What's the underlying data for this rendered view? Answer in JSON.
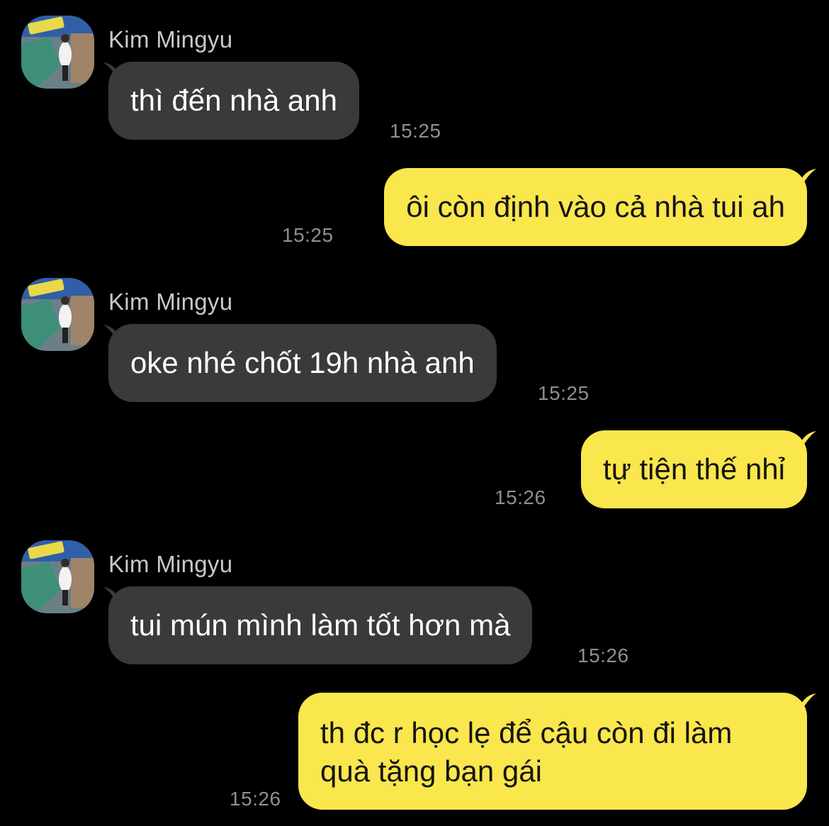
{
  "chat": {
    "messages": [
      {
        "side": "in",
        "sender": "Kim Mingyu",
        "text": "thì đến nhà anh",
        "time": "15:25"
      },
      {
        "side": "out",
        "text": "ôi còn định vào cả nhà tui ah",
        "time": "15:25"
      },
      {
        "side": "in",
        "sender": "Kim Mingyu",
        "text": "oke nhé chốt 19h nhà anh",
        "time": "15:25"
      },
      {
        "side": "out",
        "text": "tự tiện thế nhỉ",
        "time": "15:26"
      },
      {
        "side": "in",
        "sender": "Kim Mingyu",
        "text": "tui mún mình làm tốt hơn mà",
        "time": "15:26"
      },
      {
        "side": "out",
        "text": "th đc r học lẹ để cậu còn đi làm quà tặng bạn gái",
        "time": "15:26"
      }
    ]
  },
  "colors": {
    "background": "#000000",
    "incoming_bubble": "#3a3a3c",
    "outgoing_bubble": "#fae64d",
    "timestamp": "#8e8e93"
  },
  "icons": {
    "avatar": "contact-photo"
  }
}
